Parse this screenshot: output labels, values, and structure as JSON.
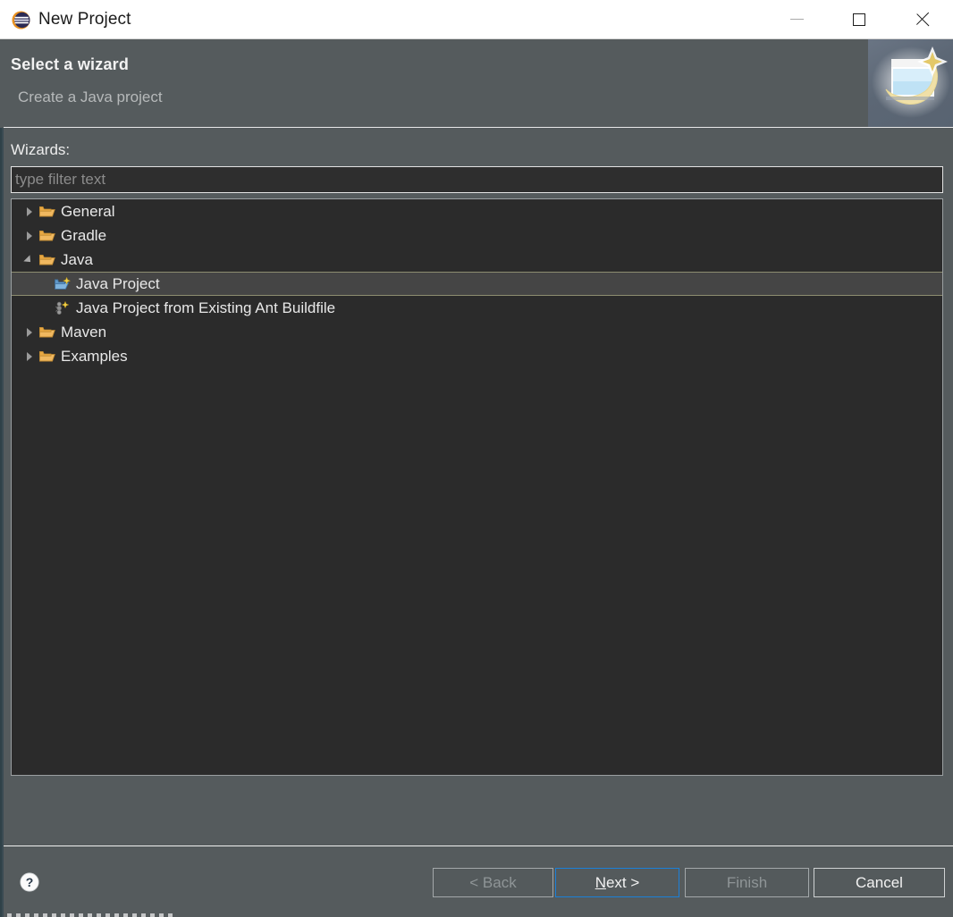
{
  "window": {
    "title": "New Project",
    "app_icon": "eclipse-icon",
    "controls": {
      "minimize": "minimize-icon",
      "maximize": "maximize-icon",
      "close": "close-icon"
    }
  },
  "header": {
    "title": "Select a wizard",
    "subtitle": "Create a Java project",
    "banner_icon": "new-wizard-banner-icon"
  },
  "body": {
    "wizards_label": "Wizards:",
    "filter": {
      "value": "",
      "placeholder": "type filter text"
    },
    "tree": [
      {
        "label": "General",
        "icon": "folder-icon",
        "state": "collapsed",
        "level": 0,
        "selected": false
      },
      {
        "label": "Gradle",
        "icon": "folder-icon",
        "state": "collapsed",
        "level": 0,
        "selected": false
      },
      {
        "label": "Java",
        "icon": "folder-icon",
        "state": "expanded",
        "level": 0,
        "selected": false
      },
      {
        "label": "Java Project",
        "icon": "java-project-icon",
        "state": "leaf",
        "level": 1,
        "selected": true
      },
      {
        "label": "Java Project from Existing Ant Buildfile",
        "icon": "ant-buildfile-icon",
        "state": "leaf",
        "level": 1,
        "selected": false
      },
      {
        "label": "Maven",
        "icon": "folder-icon",
        "state": "collapsed",
        "level": 0,
        "selected": false
      },
      {
        "label": "Examples",
        "icon": "folder-icon",
        "state": "collapsed",
        "level": 0,
        "selected": false
      }
    ]
  },
  "footer": {
    "help_icon": "help-question-icon",
    "buttons": {
      "back": {
        "label": "< Back",
        "enabled": false,
        "focused": false
      },
      "next": {
        "label_prefix": "",
        "mnemonic": "N",
        "label_suffix": "ext >",
        "enabled": true,
        "focused": true
      },
      "finish": {
        "label": "Finish",
        "enabled": false,
        "focused": false
      },
      "cancel": {
        "label": "Cancel",
        "enabled": true,
        "focused": false
      }
    }
  },
  "colors": {
    "dialog_bg": "#555b5d",
    "titlebar_bg": "#ffffff",
    "tree_bg": "#2b2b2b",
    "selection_bg": "#454545",
    "selection_border": "#8d8d70",
    "focus_blue": "#1b80d8",
    "text_primary": "#f2f2f2",
    "text_muted": "#b6b9ba",
    "text_disabled": "#8f9597"
  }
}
